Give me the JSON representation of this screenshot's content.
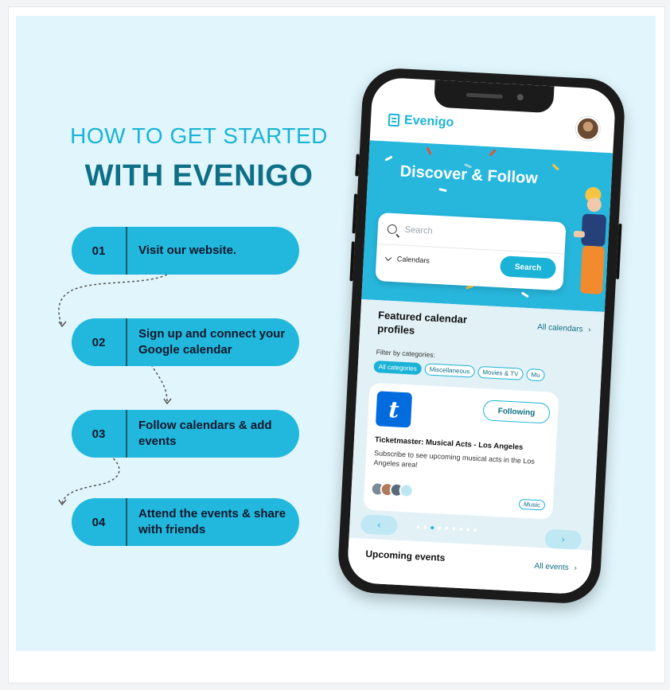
{
  "heading": {
    "line1": "HOW TO GET STARTED",
    "line2": "WITH EVENIGO"
  },
  "steps": [
    {
      "num": "01",
      "text": "Visit our website."
    },
    {
      "num": "02",
      "text": "Sign up and connect your Google calendar"
    },
    {
      "num": "03",
      "text": "Follow calendars & add events"
    },
    {
      "num": "04",
      "text": "Attend the events & share with friends"
    }
  ],
  "colors": {
    "accent": "#1ab3d7",
    "dark_teal": "#0e6f86",
    "background": "#e0f6fc",
    "step_fill": "#22b7dd",
    "ticketmaster_blue": "#026cdf"
  },
  "app": {
    "brand": "Evenigo",
    "hero_title": "Discover & Follow",
    "search_placeholder": "Search",
    "calendars_label": "Calendars",
    "search_button": "Search",
    "featured_title": "Featured calendar profiles",
    "all_calendars": "All calendars",
    "filter_label": "Filter by categories:",
    "categories": [
      "All categories",
      "Miscellaneous",
      "Movies & TV",
      "Mu"
    ],
    "card": {
      "logo_letter": "t",
      "follow_button": "Following",
      "title": "Ticketmaster: Musical Acts - Los Angeles",
      "description": "Subscribe to see upcoming musical acts in the Los Angeles area!",
      "tag": "Music"
    },
    "prev_arrow": "‹",
    "next_arrow": "›",
    "upcoming_title": "Upcoming events",
    "all_events": "All events",
    "chevron": "›"
  }
}
